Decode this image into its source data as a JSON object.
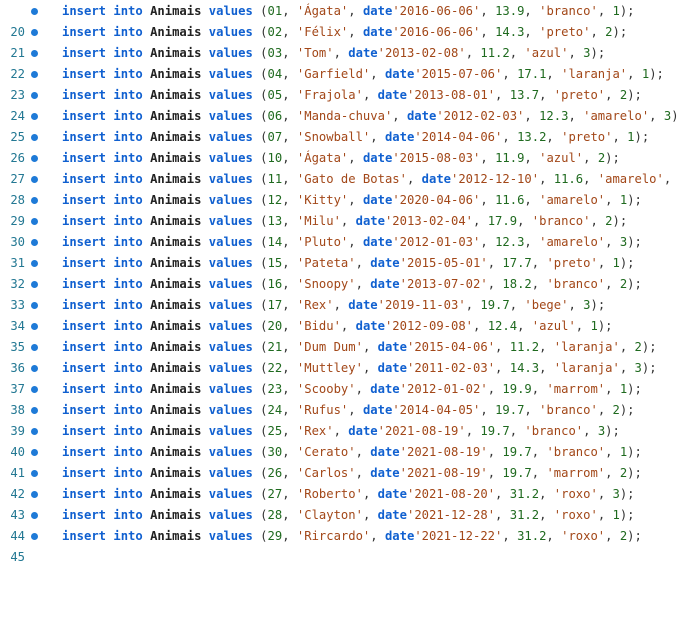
{
  "editor": {
    "colors": {
      "line_number": "#237893",
      "breakpoint": "#1e7ad7",
      "keyword": "#1060d0",
      "identifier": "#222222",
      "string": "#a24718",
      "number": "#1f6a1f"
    },
    "breakpoint_icon": "breakpoint-dot-icon",
    "statement": {
      "kw_insert": "insert",
      "kw_into": "into",
      "table": "Animais",
      "kw_values": "values"
    },
    "lines": [
      {
        "ln": "20",
        "id": "01",
        "name": "'Ágata'",
        "datekw": "date",
        "date": "'2016-06-06'",
        "weight": "13.9",
        "color": "'branco'",
        "owner": "1"
      },
      {
        "ln": "21",
        "id": "02",
        "name": "'Félix'",
        "datekw": "date",
        "date": "'2016-06-06'",
        "weight": "14.3",
        "color": "'preto'",
        "owner": "2"
      },
      {
        "ln": "22",
        "id": "03",
        "name": "'Tom'",
        "datekw": "date",
        "date": "'2013-02-08'",
        "weight": "11.2",
        "color": "'azul'",
        "owner": "3"
      },
      {
        "ln": "23",
        "id": "04",
        "name": "'Garfield'",
        "datekw": "date",
        "date": "'2015-07-06'",
        "weight": "17.1",
        "color": "'laranja'",
        "owner": "1"
      },
      {
        "ln": "24",
        "id": "05",
        "name": "'Frajola'",
        "datekw": "date",
        "date": "'2013-08-01'",
        "weight": "13.7",
        "color": "'preto'",
        "owner": "2"
      },
      {
        "ln": "25",
        "id": "06",
        "name": "'Manda-chuva'",
        "datekw": "date",
        "date": "'2012-02-03'",
        "weight": "12.3",
        "color": "'amarelo'",
        "owner": "3"
      },
      {
        "ln": "26",
        "id": "07",
        "name": "'Snowball'",
        "datekw": "date",
        "date": "'2014-04-06'",
        "weight": "13.2",
        "color": "'preto'",
        "owner": "1"
      },
      {
        "ln": "27",
        "id": "10",
        "name": "'Ágata'",
        "datekw": "date",
        "date": "'2015-08-03'",
        "weight": "11.9",
        "color": "'azul'",
        "owner": "2"
      },
      {
        "ln": "28",
        "id": "11",
        "name": "'Gato de Botas'",
        "datekw": "date",
        "date": "'2012-12-10'",
        "weight": "11.6",
        "color": "'amarelo'",
        "owner": "3"
      },
      {
        "ln": "29",
        "id": "12",
        "name": "'Kitty'",
        "datekw": "date",
        "date": "'2020-04-06'",
        "weight": "11.6",
        "color": "'amarelo'",
        "owner": "1"
      },
      {
        "ln": "30",
        "id": "13",
        "name": "'Milu'",
        "datekw": "date",
        "date": "'2013-02-04'",
        "weight": "17.9",
        "color": "'branco'",
        "owner": "2"
      },
      {
        "ln": "31",
        "id": "14",
        "name": "'Pluto'",
        "datekw": "date",
        "date": "'2012-01-03'",
        "weight": "12.3",
        "color": "'amarelo'",
        "owner": "3"
      },
      {
        "ln": "32",
        "id": "15",
        "name": "'Pateta'",
        "datekw": "date",
        "date": "'2015-05-01'",
        "weight": "17.7",
        "color": "'preto'",
        "owner": "1"
      },
      {
        "ln": "33",
        "id": "16",
        "name": "'Snoopy'",
        "datekw": "date",
        "date": "'2013-07-02'",
        "weight": "18.2",
        "color": "'branco'",
        "owner": "2"
      },
      {
        "ln": "34",
        "id": "17",
        "name": "'Rex'",
        "datekw": "date",
        "date": "'2019-11-03'",
        "weight": "19.7",
        "color": "'bege'",
        "owner": "3"
      },
      {
        "ln": "35",
        "id": "20",
        "name": "'Bidu'",
        "datekw": "date",
        "date": "'2012-09-08'",
        "weight": "12.4",
        "color": "'azul'",
        "owner": "1"
      },
      {
        "ln": "36",
        "id": "21",
        "name": "'Dum Dum'",
        "datekw": "date",
        "date": "'2015-04-06'",
        "weight": "11.2",
        "color": "'laranja'",
        "owner": "2"
      },
      {
        "ln": "37",
        "id": "22",
        "name": "'Muttley'",
        "datekw": "date",
        "date": "'2011-02-03'",
        "weight": "14.3",
        "color": "'laranja'",
        "owner": "3"
      },
      {
        "ln": "38",
        "id": "23",
        "name": "'Scooby'",
        "datekw": "date",
        "date": "'2012-01-02'",
        "weight": "19.9",
        "color": "'marrom'",
        "owner": "1"
      },
      {
        "ln": "39",
        "id": "24",
        "name": "'Rufus'",
        "datekw": "date",
        "date": "'2014-04-05'",
        "weight": "19.7",
        "color": "'branco'",
        "owner": "2"
      },
      {
        "ln": "40",
        "id": "25",
        "name": "'Rex'",
        "datekw": "date",
        "date": "'2021-08-19'",
        "weight": "19.7",
        "color": "'branco'",
        "owner": "3"
      },
      {
        "ln": "41",
        "id": "30",
        "name": "'Cerato'",
        "datekw": "date",
        "date": "'2021-08-19'",
        "weight": "19.7",
        "color": "'branco'",
        "owner": "1"
      },
      {
        "ln": "42",
        "id": "26",
        "name": "'Carlos'",
        "datekw": "date",
        "date": "'2021-08-19'",
        "weight": "19.7",
        "color": "'marrom'",
        "owner": "2"
      },
      {
        "ln": "43",
        "id": "27",
        "name": "'Roberto'",
        "datekw": "date",
        "date": "'2021-08-20'",
        "weight": "31.2",
        "color": "'roxo'",
        "owner": "3"
      },
      {
        "ln": "44",
        "id": "28",
        "name": "'Clayton'",
        "datekw": "date",
        "date": "'2021-12-28'",
        "weight": "31.2",
        "color": "'roxo'",
        "owner": "1"
      },
      {
        "ln": "45",
        "id": "29",
        "name": "'Rircardo'",
        "datekw": "date",
        "date": "'2021-12-22'",
        "weight": "31.2",
        "color": "'roxo'",
        "owner": "2"
      }
    ]
  }
}
